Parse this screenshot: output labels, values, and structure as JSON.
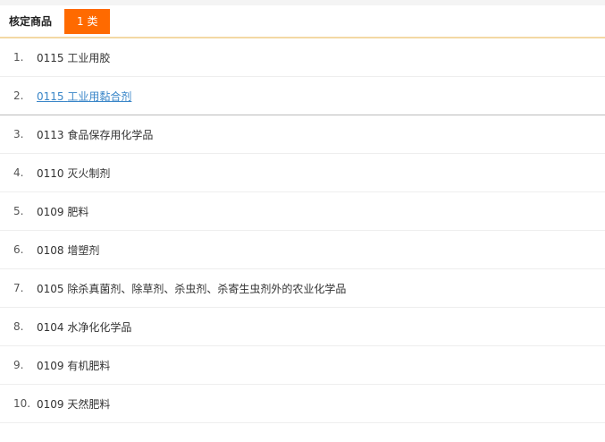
{
  "header": {
    "title": "核定商品",
    "badge": "1 类",
    "accent_color": "#ff6a00"
  },
  "items": [
    {
      "index": "1.",
      "code": "0115",
      "name": "工业用胶"
    },
    {
      "index": "2.",
      "code": "0115",
      "name": "工业用黏合剂"
    },
    {
      "index": "3.",
      "code": "0113",
      "name": "食品保存用化学品"
    },
    {
      "index": "4.",
      "code": "0110",
      "name": "灭火制剂"
    },
    {
      "index": "5.",
      "code": "0109",
      "name": "肥料"
    },
    {
      "index": "6.",
      "code": "0108",
      "name": "增塑剂"
    },
    {
      "index": "7.",
      "code": "0105",
      "name": "除杀真菌剂、除草剂、杀虫剂、杀寄生虫剂外的农业化学品"
    },
    {
      "index": "8.",
      "code": "0104",
      "name": "水净化化学品"
    },
    {
      "index": "9.",
      "code": "0109",
      "name": "有机肥料"
    },
    {
      "index": "10.",
      "code": "0109",
      "name": "天然肥料"
    }
  ],
  "link_color": "#3a86c8"
}
